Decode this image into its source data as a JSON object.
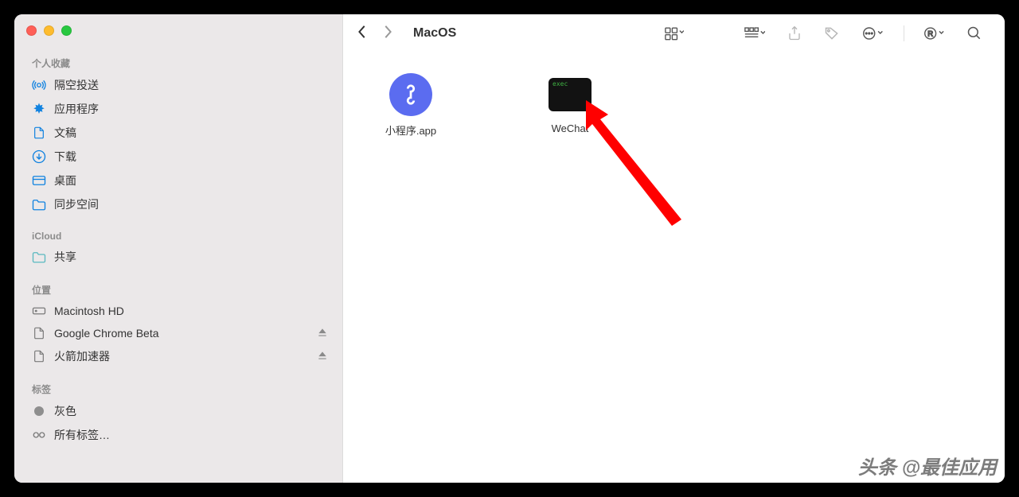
{
  "sidebar": {
    "sections": {
      "favorites": {
        "title": "个人收藏",
        "items": [
          "隔空投送",
          "应用程序",
          "文稿",
          "下载",
          "桌面",
          "同步空间"
        ]
      },
      "icloud": {
        "title": "iCloud",
        "items": [
          "共享"
        ]
      },
      "locations": {
        "title": "位置",
        "items": [
          "Macintosh HD",
          "Google Chrome Beta",
          "火箭加速器"
        ]
      },
      "tags": {
        "title": "标签",
        "items": [
          "灰色",
          "所有标签…"
        ]
      }
    }
  },
  "toolbar": {
    "title": "MacOS"
  },
  "files": {
    "0": {
      "label": "小程序.app"
    },
    "1": {
      "label": "WeChat"
    }
  },
  "watermark": "头条 @最佳应用"
}
